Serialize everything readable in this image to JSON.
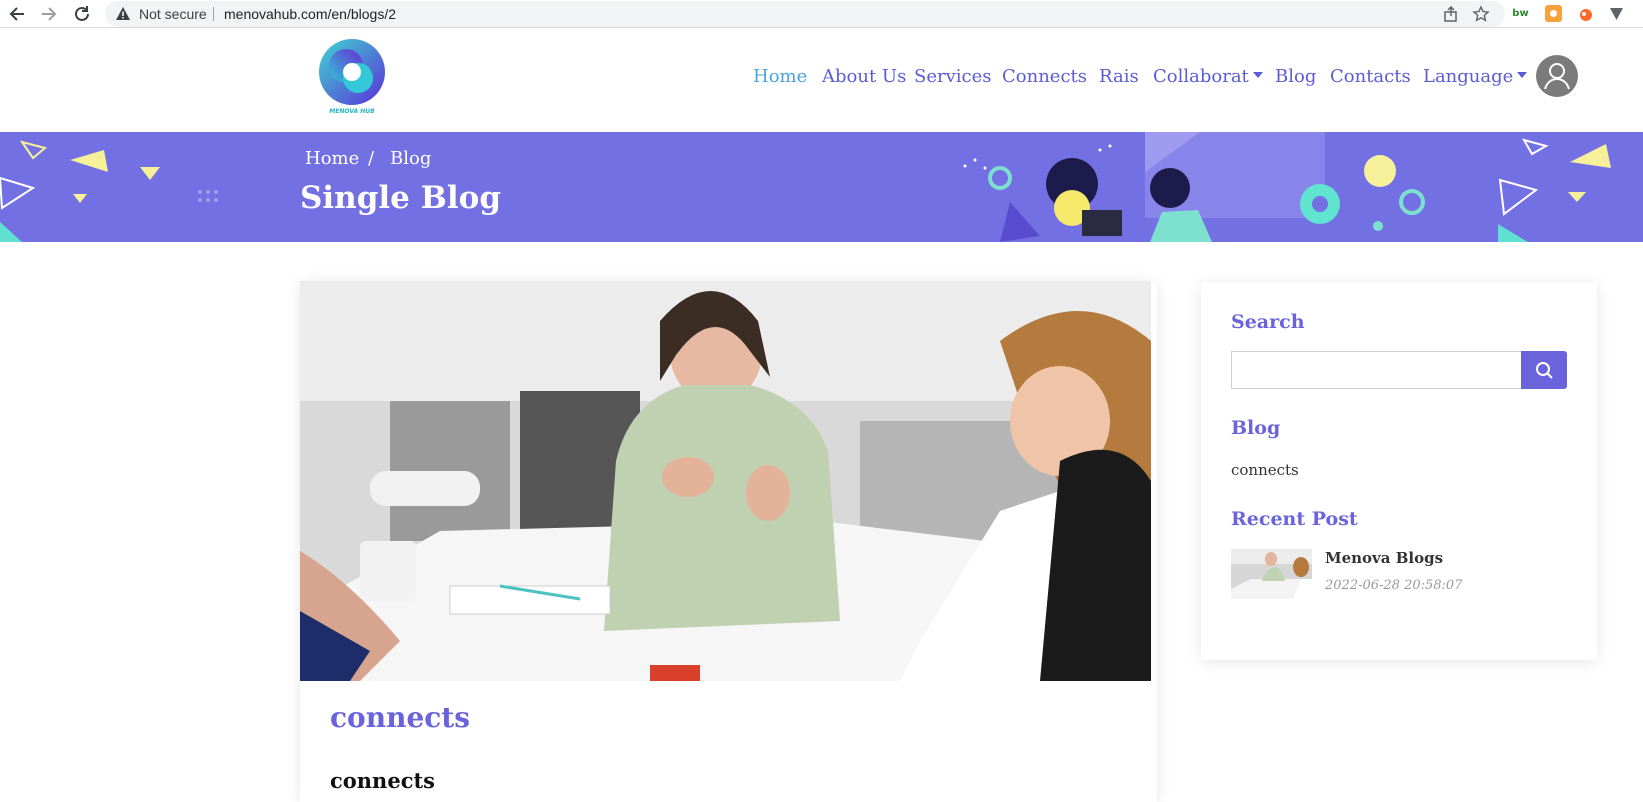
{
  "browser": {
    "security_label": "Not secure",
    "url": "menovahub.com/en/blogs/2",
    "icons": [
      "back-arrow-icon",
      "forward-arrow-icon",
      "reload-icon",
      "warning-icon",
      "share-icon",
      "star-icon"
    ],
    "extensions": [
      {
        "text": "bw",
        "color": "#2f8a2f",
        "bg": "#ffffff"
      },
      {
        "text": "",
        "color": "#ffffff",
        "bg": "#f7a23a"
      },
      {
        "text": "",
        "color": "#ffffff",
        "bg": "#ff6a2a"
      },
      {
        "text": "",
        "color": "#5f6368",
        "bg": "#ffffff"
      }
    ]
  },
  "header": {
    "logo_text": "MENOVA HUB",
    "nav": [
      {
        "label": "Home",
        "active": true
      },
      {
        "label": "About Us",
        "active": false
      },
      {
        "label": "Services",
        "active": false
      },
      {
        "label": "Connects",
        "active": false
      },
      {
        "label": "Rais",
        "active": false
      },
      {
        "label": "Collaborat",
        "active": false,
        "dropdown": true
      },
      {
        "label": "Blog",
        "active": false
      },
      {
        "label": "Contacts",
        "active": false
      },
      {
        "label": "Language",
        "active": false,
        "dropdown": true
      }
    ]
  },
  "banner": {
    "breadcrumb": [
      "Home",
      "/",
      "Blog"
    ],
    "title": "Single Blog",
    "bg_color": "#7370e3"
  },
  "article": {
    "title": "connects",
    "subtitle": "connects"
  },
  "sidebar": {
    "search_heading": "Search",
    "search_value": "",
    "blog_heading": "Blog",
    "blog_category": "connects",
    "recent_heading": "Recent Post",
    "recent_posts": [
      {
        "title": "Menova Blogs",
        "date": "2022-06-28 20:58:07"
      }
    ]
  },
  "colors": {
    "accent": "#6b63dc",
    "nav_active": "#4aa4e0"
  }
}
